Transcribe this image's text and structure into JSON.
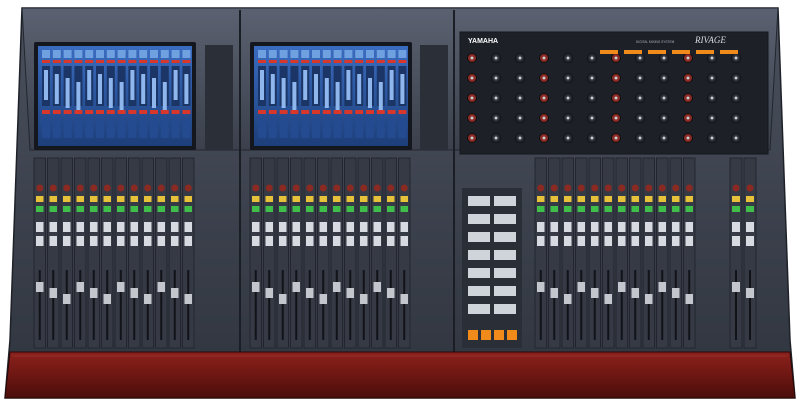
{
  "image": {
    "description_type": "product-photo",
    "brand_logo_text": "YAMAHA",
    "model_logo_text": "RIVAGE",
    "model_subtitle_text": "DIGITAL MIXING SYSTEM",
    "colors": {
      "console_body": "#3a3f4b",
      "panel_dark": "#262a33",
      "wood_armrest": "#7a1a16",
      "screen_blue": "#2d5fa8",
      "meter_red": "#d8382c",
      "meter_green": "#3fbf4a",
      "meter_yellow": "#e5c23a",
      "orange_button": "#f08a1a"
    },
    "icons": [
      "yamaha-logo",
      "touch-screen-left",
      "touch-screen-center",
      "control-panel-right",
      "fader-bank-left",
      "fader-bank-center",
      "fader-bank-right",
      "master-section",
      "wood-armrest"
    ]
  }
}
